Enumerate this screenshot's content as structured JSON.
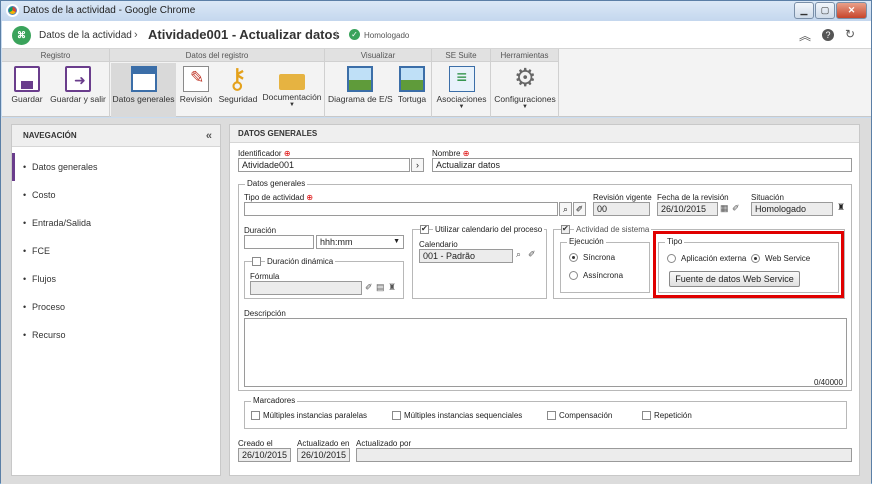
{
  "window": {
    "title": "Datos de la actividad - Google Chrome"
  },
  "header": {
    "breadcrumb": "Datos de la actividad",
    "title": "Atividade001 - Actualizar datos",
    "status": "Homologado"
  },
  "toolbar": {
    "groups": [
      "Registro",
      "Datos del registro",
      "Visualizar",
      "SE Suite",
      "Herramientas"
    ],
    "buttons": {
      "save": "Guardar",
      "save_exit": "Guardar y salir",
      "general": "Datos generales",
      "revision": "Revisión",
      "security": "Seguridad",
      "documentation": "Documentación",
      "diagram": "Diagrama de E/S",
      "tortuga": "Tortuga",
      "associations": "Asociaciones",
      "configurations": "Configuraciones"
    }
  },
  "nav": {
    "title": "NAVEGACIÓN",
    "items": [
      "Datos generales",
      "Costo",
      "Entrada/Salida",
      "FCE",
      "Flujos",
      "Proceso",
      "Recurso"
    ]
  },
  "main": {
    "title": "DATOS GENERALES",
    "identifier_label": "Identificador",
    "identifier_value": "Atividade001",
    "name_label": "Nombre",
    "name_value": "Actualizar datos",
    "general_legend": "Datos generales",
    "activity_type_label": "Tipo de actividad",
    "activity_type_value": "",
    "revision_label": "Revisión vigente",
    "revision_value": "00",
    "revision_date_label": "Fecha de la revisión",
    "revision_date_value": "26/10/2015",
    "situation_label": "Situación",
    "situation_value": "Homologado",
    "duration_label": "Duración",
    "duration_value": "",
    "duration_unit": "hhh:mm",
    "dynamic_duration_label": "Duración dinámica",
    "formula_label": "Fórmula",
    "formula_value": "",
    "use_calendar_label": "Utilizar calendario del proceso",
    "calendar_label": "Calendario",
    "calendar_value": "001 - Padrão",
    "system_activity_label": "Actividad de sistema",
    "execution_legend": "Ejecución",
    "sync_label": "Síncrona",
    "async_label": "Assíncrona",
    "type_legend": "Tipo",
    "external_app_label": "Aplicación externa",
    "web_service_label": "Web Service",
    "ws_source_button": "Fuente de datos Web Service",
    "description_label": "Descripción",
    "char_count": "0/40000",
    "markers_legend": "Marcadores",
    "markers": [
      "Múltiples instancias paralelas",
      "Múltiples instancias sequenciales",
      "Compensación",
      "Repetición"
    ],
    "created_label": "Creado el",
    "created_value": "26/10/2015",
    "updated_label": "Actualizado en",
    "updated_value": "26/10/2015",
    "updated_by_label": "Actualizado por",
    "updated_by_value": ""
  },
  "colors": {
    "accent": "#6a3d8c",
    "highlight": "#e00000",
    "status": "#3aa35b"
  }
}
